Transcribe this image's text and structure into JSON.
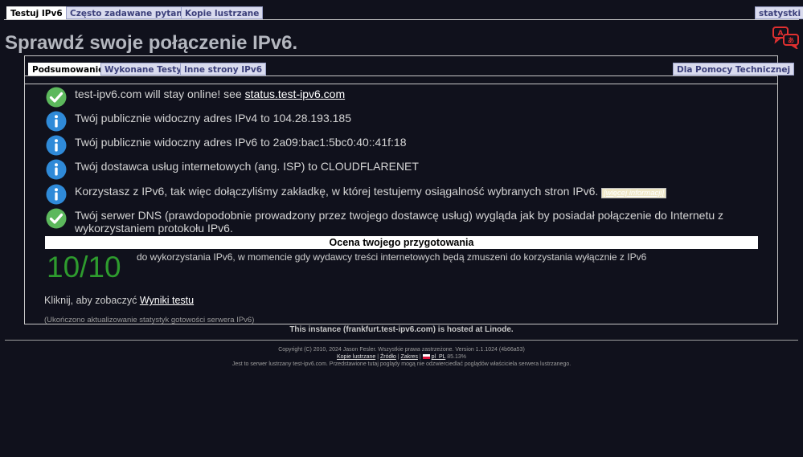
{
  "top_tabs": {
    "test": "Testuj IPv6",
    "faq": "Często zadawane pytania",
    "mirrors": "Kopie lustrzane",
    "stats": "statystki"
  },
  "page_title": "Sprawdź swoje połączenie IPv6.",
  "sub_tabs": {
    "summary": "Podsumowanie",
    "tests_run": "Wykonane Testy",
    "other_sites": "Inne strony IPv6",
    "helpdesk": "Dla Pomocy Technicznej"
  },
  "results": [
    {
      "icon": "check-icon",
      "text": "test-ipv6.com will stay online! see ",
      "link": "status.test-ipv6.com"
    },
    {
      "icon": "info-icon",
      "text": "Twój publicznie widoczny adres IPv4 to 104.28.193.185"
    },
    {
      "icon": "info-icon",
      "text": "Twój publicznie widoczny adres IPv6 to 2a09:bac1:5bc0:40::41f:18"
    },
    {
      "icon": "info-icon",
      "text": "Twój dostawca usług internetowych (ang. ISP) to CLOUDFLARENET"
    },
    {
      "icon": "info-icon",
      "text": "Korzystasz z IPv6, tak więc dołączyliśmy zakładkę, w której testujemy osiągalność wybranych stron IPv6.",
      "more": "[więcej informacji]"
    },
    {
      "icon": "check-icon",
      "text": "Twój serwer DNS (prawdopodobnie prowadzony przez twojego dostawcę usług) wygląda jak by posiadał połączenie do Internetu z wykorzystaniem protokołu IPv6."
    }
  ],
  "readiness": {
    "header": "Ocena twojego przygotowania",
    "score": "10/10",
    "description": "do wykorzystania IPv6, w momencie gdy wydawcy treści internetowych będą zmuszeni do korzystania wyłącznie z IPv6"
  },
  "click_prefix": "Kliknij, aby zobaczyć ",
  "click_link": "Wyniki testu",
  "update_note": "(Ukończono aktualizowanie statystyk gotowości serwera IPv6)",
  "hosted": "This instance (frankfurt.test-ipv6.com) is hosted at Linode.",
  "footer": {
    "copyright": "Copyright (C) 2010, 2024 Jason Fesler. Wszystkie prawa zastrzeżone. Version 1.1.1024 (4b66a53)",
    "link_mirrors": "Kopie lustrzane",
    "sep": " | ",
    "link_source": "Źródło",
    "link_range": "Zakres",
    "locale": "pl_PL",
    "percent": "85.13%",
    "mirror_note": "Jest to serwer lustrzany test-ipv6.com. Przedstawione tutaj poglądy mogą nie odzwierciedlać poglądów właściciela serwera lustrzanego."
  },
  "colors": {
    "background": "#10111c",
    "score_green": "#2e9b2e",
    "check_green": "#5cb85c",
    "info_blue": "#2f8ad8"
  }
}
